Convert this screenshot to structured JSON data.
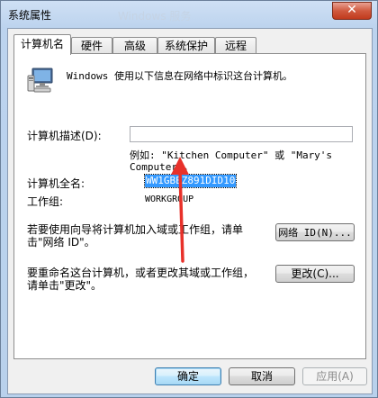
{
  "window": {
    "title": "系统属性",
    "ghost_title": "Windows 服务",
    "close_symbol": "✕"
  },
  "tabs": [
    {
      "label": "计算机名",
      "active": true
    },
    {
      "label": "硬件",
      "active": false
    },
    {
      "label": "高级",
      "active": false
    },
    {
      "label": "系统保护",
      "active": false
    },
    {
      "label": "远程",
      "active": false
    }
  ],
  "panel": {
    "intro": "Windows 使用以下信息在网络中标识这台计算机。",
    "description_label": "计算机描述(D):",
    "description_value": "",
    "example_line1": "例如: \"Kitchen Computer\" 或 \"Mary's",
    "example_line2": "Computer\"。",
    "full_name_label": "计算机全名:",
    "full_name_value": "WW1GBEZ891DID10",
    "workgroup_label": "工作组:",
    "workgroup_value": "WORKGROUP",
    "wizard_text_line1": "若要使用向导将计算机加入域或工作组，请单",
    "wizard_text_line2": "击\"网络 ID\"。",
    "network_id_button": "网络 ID(N)...",
    "rename_text_line1": "要重命名这台计算机，或者更改其域或工作组，",
    "rename_text_line2": "请单击\"更改\"。",
    "change_button": "更改(C)..."
  },
  "footer": {
    "ok": "确定",
    "cancel": "取消",
    "apply": "应用(A)"
  },
  "colors": {
    "selection": "#3399ff",
    "annotation_arrow": "#e8312a"
  }
}
